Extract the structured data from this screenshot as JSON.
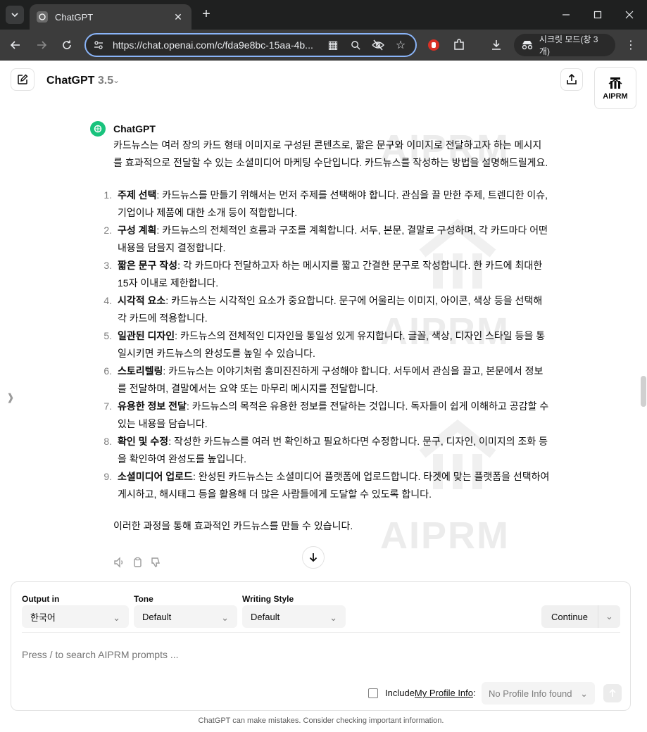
{
  "browser": {
    "tab_title": "ChatGPT",
    "url": "https://chat.openai.com/c/fda9e8bc-15aa-4b...",
    "incognito_label": "시크릿 모드(창 3개)"
  },
  "header": {
    "model_name": "ChatGPT",
    "model_version": "3.5",
    "aiprm_label": "AIPRM"
  },
  "watermark": "AIPRM",
  "message": {
    "author": "ChatGPT",
    "intro": "카드뉴스는 여러 장의 카드 형태 이미지로 구성된 콘텐츠로, 짧은 문구와 이미지로 전달하고자 하는 메시지를 효과적으로 전달할 수 있는 소셜미디어 마케팅 수단입니다. 카드뉴스를 작성하는 방법을 설명해드릴게요.",
    "steps": [
      {
        "num": "1.",
        "title": "주제 선택",
        "text": ": 카드뉴스를 만들기 위해서는 먼저 주제를 선택해야 합니다. 관심을 끌 만한 주제, 트렌디한 이슈, 기업이나 제품에 대한 소개 등이 적합합니다."
      },
      {
        "num": "2.",
        "title": "구성 계획",
        "text": ": 카드뉴스의 전체적인 흐름과 구조를 계획합니다. 서두, 본문, 결말로 구성하며, 각 카드마다 어떤 내용을 담을지 결정합니다."
      },
      {
        "num": "3.",
        "title": "짧은 문구 작성",
        "text": ": 각 카드마다 전달하고자 하는 메시지를 짧고 간결한 문구로 작성합니다. 한 카드에 최대한 15자 이내로 제한합니다."
      },
      {
        "num": "4.",
        "title": "시각적 요소",
        "text": ": 카드뉴스는 시각적인 요소가 중요합니다. 문구에 어울리는 이미지, 아이콘, 색상 등을 선택해 각 카드에 적용합니다."
      },
      {
        "num": "5.",
        "title": "일관된 디자인",
        "text": ": 카드뉴스의 전체적인 디자인을 통일성 있게 유지합니다. 글꼴, 색상, 디자인 스타일 등을 통일시키면 카드뉴스의 완성도를 높일 수 있습니다."
      },
      {
        "num": "6.",
        "title": "스토리텔링",
        "text": ": 카드뉴스는 이야기처럼 흥미진진하게 구성해야 합니다. 서두에서 관심을 끌고, 본문에서 정보를 전달하며, 결말에서는 요약 또는 마무리 메시지를 전달합니다."
      },
      {
        "num": "7.",
        "title": "유용한 정보 전달",
        "text": ": 카드뉴스의 목적은 유용한 정보를 전달하는 것입니다. 독자들이 쉽게 이해하고 공감할 수 있는 내용을 담습니다."
      },
      {
        "num": "8.",
        "title": "확인 및 수정",
        "text": ": 작성한 카드뉴스를 여러 번 확인하고 필요하다면 수정합니다. 문구, 디자인, 이미지의 조화 등을 확인하여 완성도를 높입니다."
      },
      {
        "num": "9.",
        "title": "소셜미디어 업로드",
        "text": ": 완성된 카드뉴스는 소셜미디어 플랫폼에 업로드합니다. 타겟에 맞는 플랫폼을 선택하여 게시하고, 해시태그 등을 활용해 더 많은 사람들에게 도달할 수 있도록 합니다."
      }
    ],
    "outro": "이러한 과정을 통해 효과적인 카드뉴스를 만들 수 있습니다."
  },
  "panel": {
    "output_label": "Output in",
    "output_value": "한국어",
    "tone_label": "Tone",
    "tone_value": "Default",
    "style_label": "Writing Style",
    "style_value": "Default",
    "continue_label": "Continue",
    "prompt_placeholder": "Press / to search AIPRM prompts ...",
    "include_prefix": "Include ",
    "include_link": "My Profile Info",
    "include_suffix": ":",
    "profile_value": "No Profile Info found"
  },
  "footer_note": "ChatGPT can make mistakes. Consider checking important information."
}
